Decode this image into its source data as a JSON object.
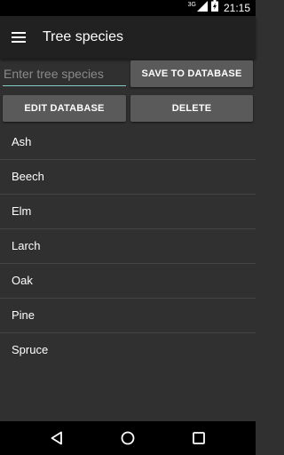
{
  "status_bar": {
    "network_label": "3G",
    "time": "21:15",
    "icons": [
      "signal-icon",
      "battery-charging-icon"
    ]
  },
  "app_bar": {
    "title": "Tree species",
    "menu_icon": "menu-icon"
  },
  "form": {
    "input_placeholder": "Enter tree species",
    "input_value": "",
    "accent_color": "#80cbc4",
    "save_label": "SAVE TO DATABASE",
    "edit_label": "EDIT DATABASE",
    "delete_label": "DELETE"
  },
  "species": [
    "Ash",
    "Beech",
    "Elm",
    "Larch",
    "Oak",
    "Pine",
    "Spruce"
  ],
  "nav_bar": {
    "icons": [
      "back-icon",
      "home-icon",
      "recents-icon"
    ]
  }
}
